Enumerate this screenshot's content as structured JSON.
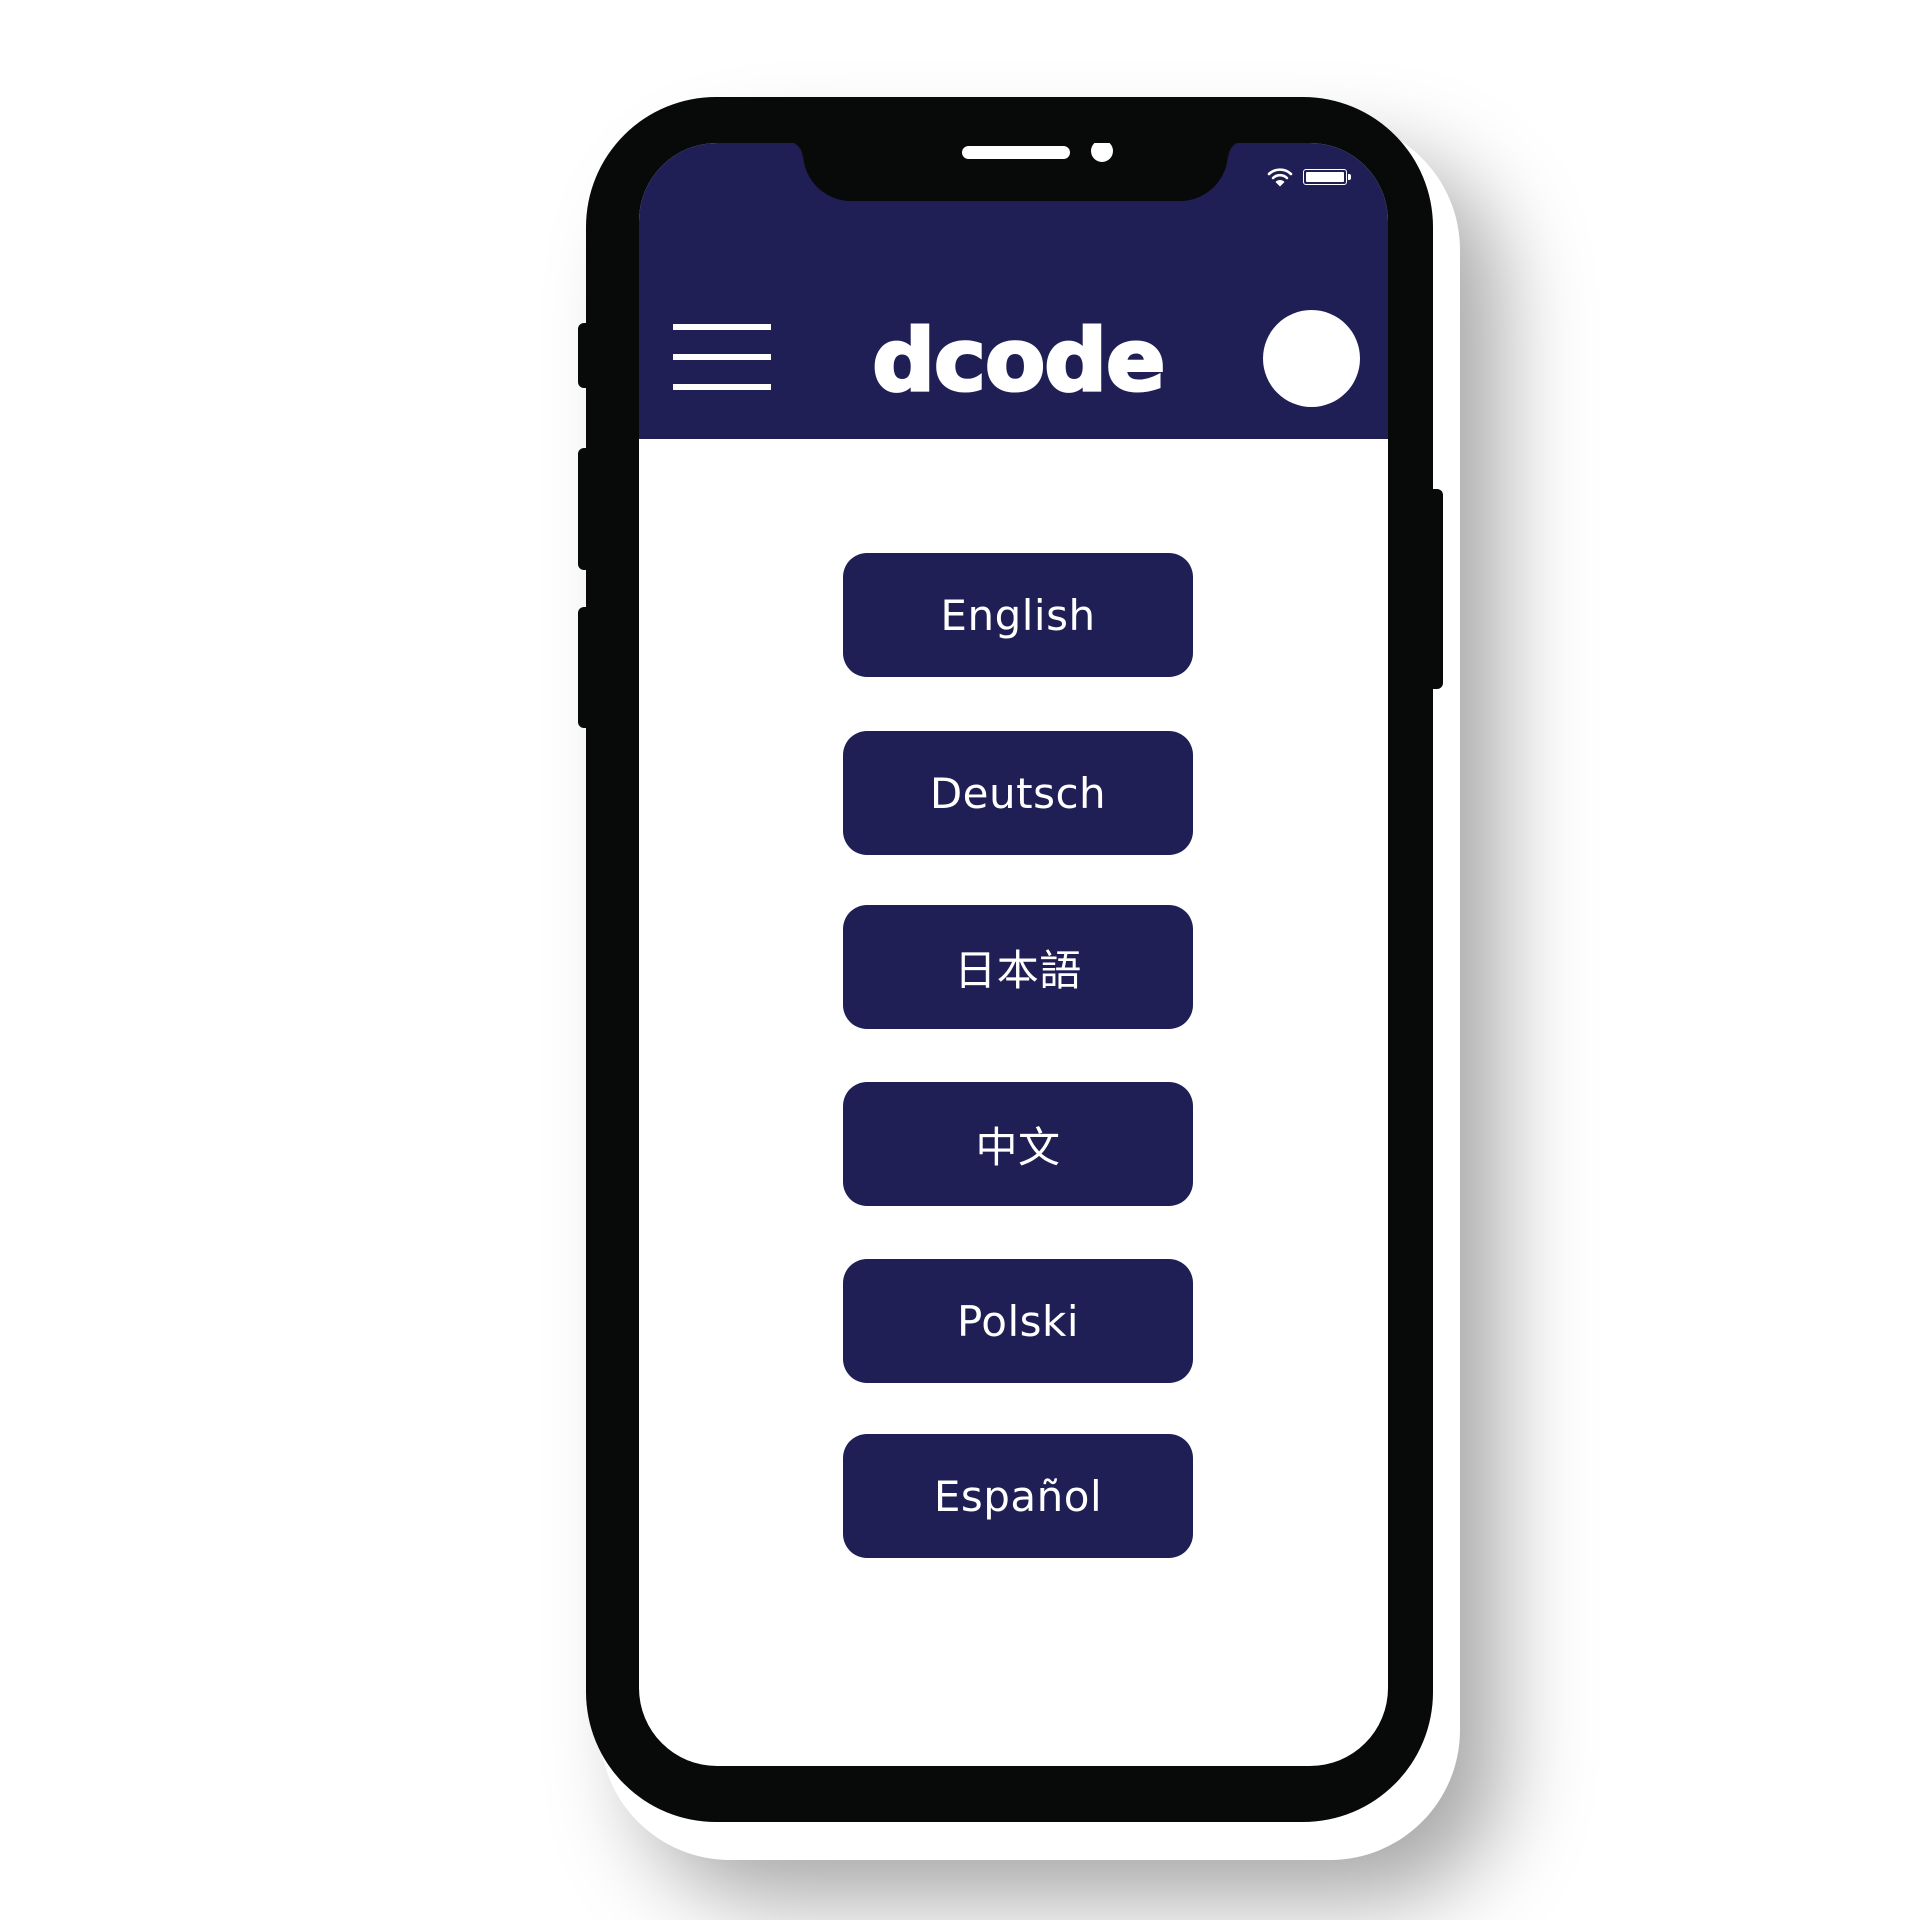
{
  "app": {
    "title": "dcode"
  },
  "status_bar": {
    "wifi_icon": "wifi-icon",
    "battery_icon": "battery-icon",
    "battery_level": 1.0
  },
  "header": {
    "menu_icon": "hamburger-menu-icon",
    "logo_text": "dcode",
    "avatar": "profile-avatar"
  },
  "languages": [
    {
      "label": "English"
    },
    {
      "label": "Deutsch"
    },
    {
      "label": "日本語"
    },
    {
      "label": "中文"
    },
    {
      "label": "Polski"
    },
    {
      "label": "Español"
    }
  ],
  "colors": {
    "brand_navy": "#201f55",
    "phone_frame": "#080a09",
    "text_on_brand": "#ffffff",
    "screen_background": "#ffffff"
  }
}
